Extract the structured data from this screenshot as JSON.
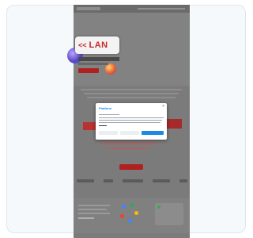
{
  "site": {
    "hero": {
      "badge_text": "LAN",
      "badge_icon": "chevron-double-left-icon"
    }
  },
  "cookie_dialog": {
    "brand": "Platform",
    "close_icon": "close-icon"
  },
  "colors": {
    "brand_red": "#c62828",
    "dialog_accent": "#1e88e5"
  }
}
